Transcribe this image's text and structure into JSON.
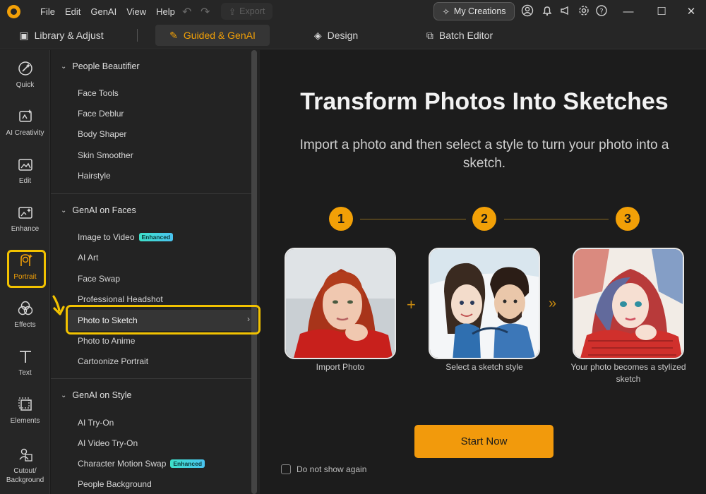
{
  "menu": {
    "items": [
      "File",
      "Edit",
      "GenAI",
      "View",
      "Help"
    ],
    "export_label": "Export",
    "my_creations_label": "My Creations"
  },
  "tabs": [
    {
      "label": "Library & Adjust"
    },
    {
      "label": "Guided & GenAI"
    },
    {
      "label": "Design"
    },
    {
      "label": "Batch Editor"
    }
  ],
  "rail": [
    {
      "label": "Quick",
      "icon": "magic-wand-icon"
    },
    {
      "label": "AI Creativity",
      "icon": "ai-creativity-icon"
    },
    {
      "label": "Edit",
      "icon": "edit-image-icon"
    },
    {
      "label": "Enhance",
      "icon": "enhance-icon"
    },
    {
      "label": "Portrait",
      "icon": "portrait-icon"
    },
    {
      "label": "Effects",
      "icon": "effects-icon"
    },
    {
      "label": "Text",
      "icon": "text-icon"
    },
    {
      "label": "Elements",
      "icon": "elements-icon"
    },
    {
      "label": "Cutout/\nBackground",
      "icon": "cutout-icon"
    }
  ],
  "panel": {
    "sections": [
      {
        "title": "People Beautifier",
        "items": [
          "Face Tools",
          "Face Deblur",
          "Body Shaper",
          "Skin Smoother",
          "Hairstyle"
        ]
      },
      {
        "title": "GenAI on Faces",
        "items": [
          "Image to Video",
          "AI Art",
          "Face Swap",
          "Professional Headshot",
          "Photo to Sketch",
          "Photo to Anime",
          "Cartoonize Portrait"
        ]
      },
      {
        "title": "GenAI on Style",
        "items": [
          "AI Try-On",
          "AI Video Try-On",
          "Character Motion Swap",
          "People Background"
        ]
      }
    ],
    "badge_label": "Enhanced"
  },
  "main": {
    "title": "Transform Photos Into Sketches",
    "subtitle": "Import a photo and then select a style to turn your photo into a sketch.",
    "steps": [
      "1",
      "2",
      "3"
    ],
    "captions": [
      "Import Photo",
      "Select a sketch style",
      "Your photo becomes a stylized sketch"
    ],
    "start_label": "Start Now",
    "dont_show_label": "Do not show again"
  },
  "colors": {
    "accent": "#f2a007",
    "highlight": "#f2c200",
    "background": "#1c1c1c"
  }
}
